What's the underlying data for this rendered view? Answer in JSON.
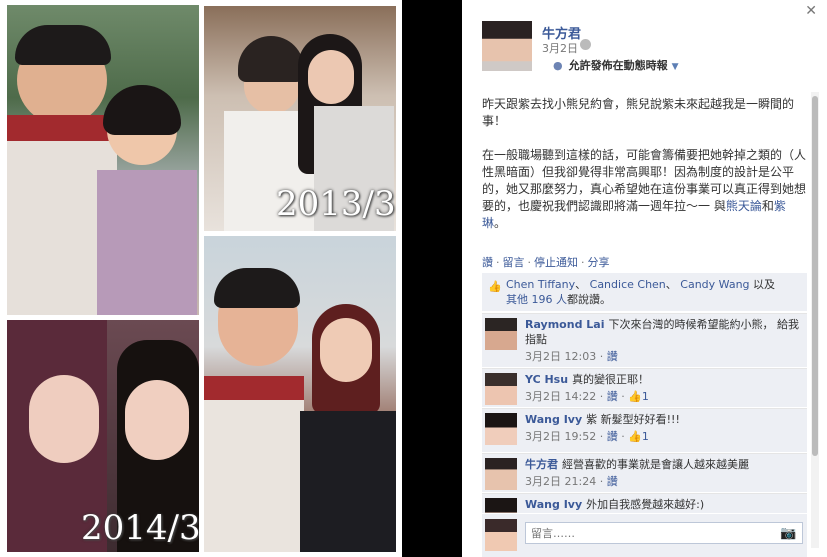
{
  "photo": {
    "captions": [
      "2013/3",
      "2014/3"
    ],
    "colors": {
      "frame": "#ffffff",
      "background": "#000000"
    }
  },
  "post": {
    "close_icon": "close-icon",
    "author": "牛方君",
    "date": "3月2日",
    "privacy_icon": "globe-icon",
    "visibility": "允許發佈在動態時報",
    "paragraph1": "昨天跟紫去找小熊兒約會，熊兒說紫未來起越我是一瞬間的事！",
    "paragraph2_text": "在一般職場聽到這樣的話，可能會籌備要把她幹掉之類的（人性黑暗面）但我卻覺得非常高興耶！因為制度的設計是公平的，她又那麼努力，真心希望她在這份事業可以真正得到她想要的，也慶祝我們認識即將滿一週年拉～一 與",
    "paragraph2_link1": "熊天論",
    "paragraph2_and": "和",
    "paragraph2_link2": "紫琳",
    "paragraph2_end": "。"
  },
  "actions": {
    "like": "讚",
    "comment": "留言",
    "stop": "停止通知",
    "share": "分享",
    "separator": "·"
  },
  "likes": {
    "icon": "thumbs-up-icon",
    "name1": "Chen Tiffany",
    "name2": "Candice Chen",
    "name3": "Candy Wang",
    "and": "以及",
    "others": "其他 196 人",
    "suffix": "都說讚。",
    "comma": "、"
  },
  "comments": [
    {
      "name": "Raymond Lai",
      "text": "下次來台灣的時候希望能約小熊， 給我指點",
      "time": "3月2日 12:03",
      "like": "讚",
      "likes": ""
    },
    {
      "name": "YC Hsu",
      "text": "真的變很正耶！",
      "time": "3月2日 14:22",
      "like": "讚",
      "likes": "1"
    },
    {
      "name": "Wang Ivy",
      "text": "紫 新髮型好好看!!!",
      "time": "3月2日 19:52",
      "like": "讚",
      "likes": "1"
    },
    {
      "name": "牛方君",
      "text": "經營喜歡的事業就是會讓人越來越美麗",
      "time": "3月2日 21:24",
      "like": "讚",
      "likes": ""
    },
    {
      "name": "Wang Ivy",
      "text": "外加自我感覺越來越好:)",
      "time": "",
      "like": "",
      "likes": ""
    }
  ],
  "composer": {
    "placeholder": "留言……",
    "camera_icon": "camera-icon"
  }
}
